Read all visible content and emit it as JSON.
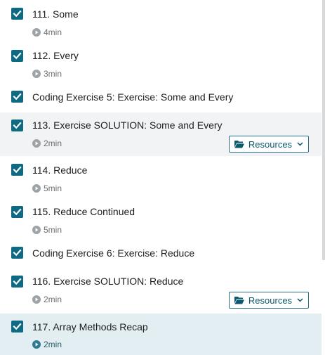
{
  "items": [
    {
      "title": "111. Some",
      "duration": "4min"
    },
    {
      "title": "112. Every",
      "duration": "3min"
    },
    {
      "title": "Coding Exercise 5: Exercise: Some and Every"
    },
    {
      "title": "113. Exercise SOLUTION: Some and Every",
      "duration": "2min",
      "resources": "Resources"
    },
    {
      "title": "114. Reduce",
      "duration": "5min"
    },
    {
      "title": "115. Reduce Continued",
      "duration": "5min"
    },
    {
      "title": "Coding Exercise 6: Exercise: Reduce"
    },
    {
      "title": "116. Exercise SOLUTION: Reduce",
      "duration": "2min",
      "resources": "Resources"
    },
    {
      "title": "117. Array Methods Recap",
      "duration": "2min"
    }
  ],
  "colors": {
    "checkbox": "#0d6a82",
    "accent": "#0d5a70",
    "hover_row": "#f2f3f5",
    "active_row": "#e2eef2"
  }
}
